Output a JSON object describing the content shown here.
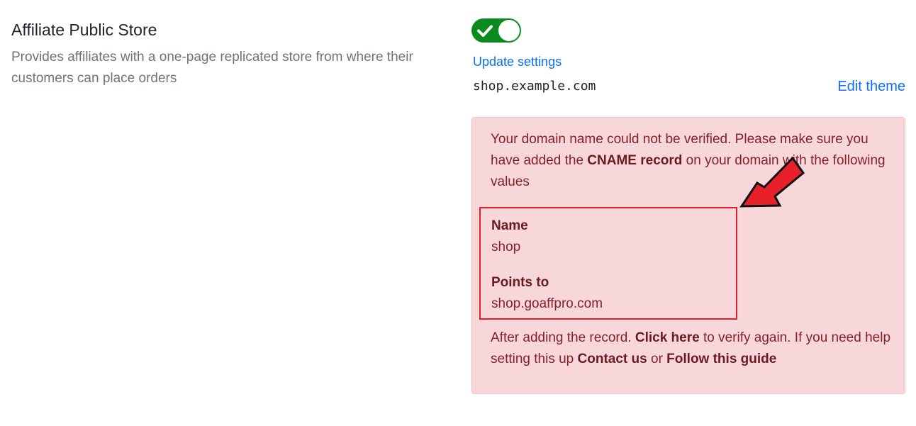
{
  "setting": {
    "title": "Affiliate Public Store",
    "description": "Provides affiliates with a one-page replicated store from where their customers can place orders"
  },
  "toggle": {
    "state": "on",
    "icon": "check-icon",
    "color": "#0b8a1f"
  },
  "update_settings_label": "Update settings",
  "domain": "shop.example.com",
  "edit_theme_label": "Edit theme",
  "alert": {
    "intro_part1": "Your domain name could not be verified. Please make sure you have added the ",
    "intro_bold": "CNAME record",
    "intro_part2": " on your domain with the following values",
    "name_label": "Name",
    "name_value": "shop",
    "points_to_label": "Points to",
    "points_to_value": "shop.goaffpro.com",
    "footer_part1": "After adding the record. ",
    "click_here": "Click here",
    "footer_part2": " to verify again. If you need help setting this up ",
    "contact_us": "Contact us",
    "footer_or": " or ",
    "follow_guide": "Follow this guide"
  },
  "colors": {
    "link": "#0d6efd",
    "alert_bg": "#f8d7da",
    "alert_text": "#842029",
    "highlight_box": "#e0212b",
    "arrow": "#e8202a"
  }
}
